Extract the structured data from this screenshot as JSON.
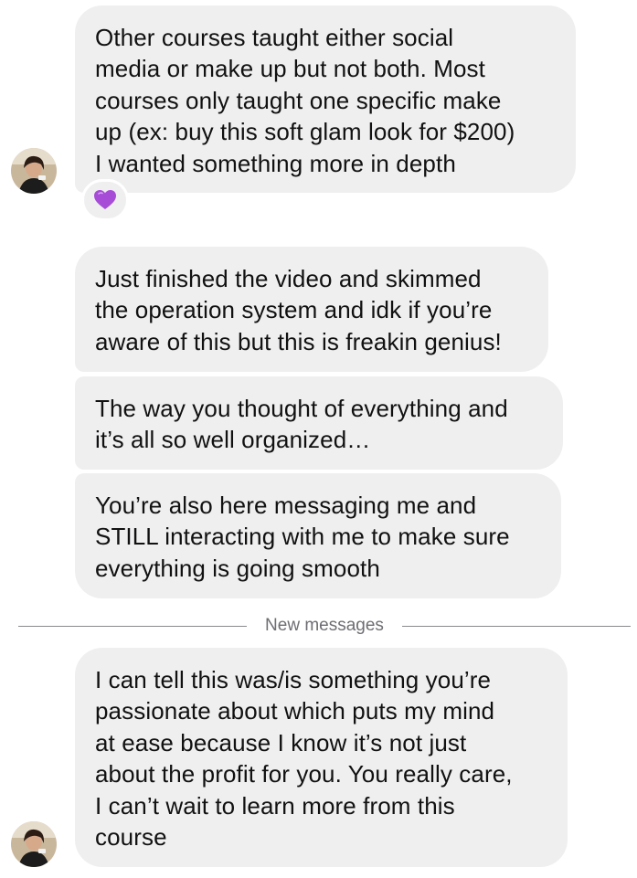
{
  "messages": [
    {
      "lines": [
        "Other courses taught either social",
        "media or make up but not both. Most",
        "courses only taught one specific make",
        "up (ex: buy this soft glam look for $200)",
        "I wanted something more in depth"
      ],
      "reaction": "purple-heart"
    },
    {
      "lines": [
        "Just finished the video and skimmed",
        "the operation system and idk if you’re",
        "aware of this but this is freakin genius!"
      ]
    },
    {
      "lines": [
        "The way you thought of everything and",
        "it’s all so well organized…"
      ]
    },
    {
      "lines": [
        "You’re also here messaging me and",
        "STILL interacting with me to make sure",
        "everything is going smooth"
      ]
    },
    {
      "lines": [
        "I can tell this was/is something you’re",
        "passionate about which puts my mind",
        "at ease because I know it’s not just",
        "about the profit for you. You really care,",
        "I can’t wait to learn more from this",
        "course"
      ]
    }
  ],
  "divider": {
    "label": "New messages"
  },
  "colors": {
    "bubble": "#efeff0",
    "text": "#111111",
    "divider_text": "#6e6e73",
    "divider_line": "#8a8a8e",
    "reaction_heart": "#a64cd6"
  },
  "icons": {
    "reaction": "purple-heart-icon",
    "avatar": "sender-avatar"
  }
}
